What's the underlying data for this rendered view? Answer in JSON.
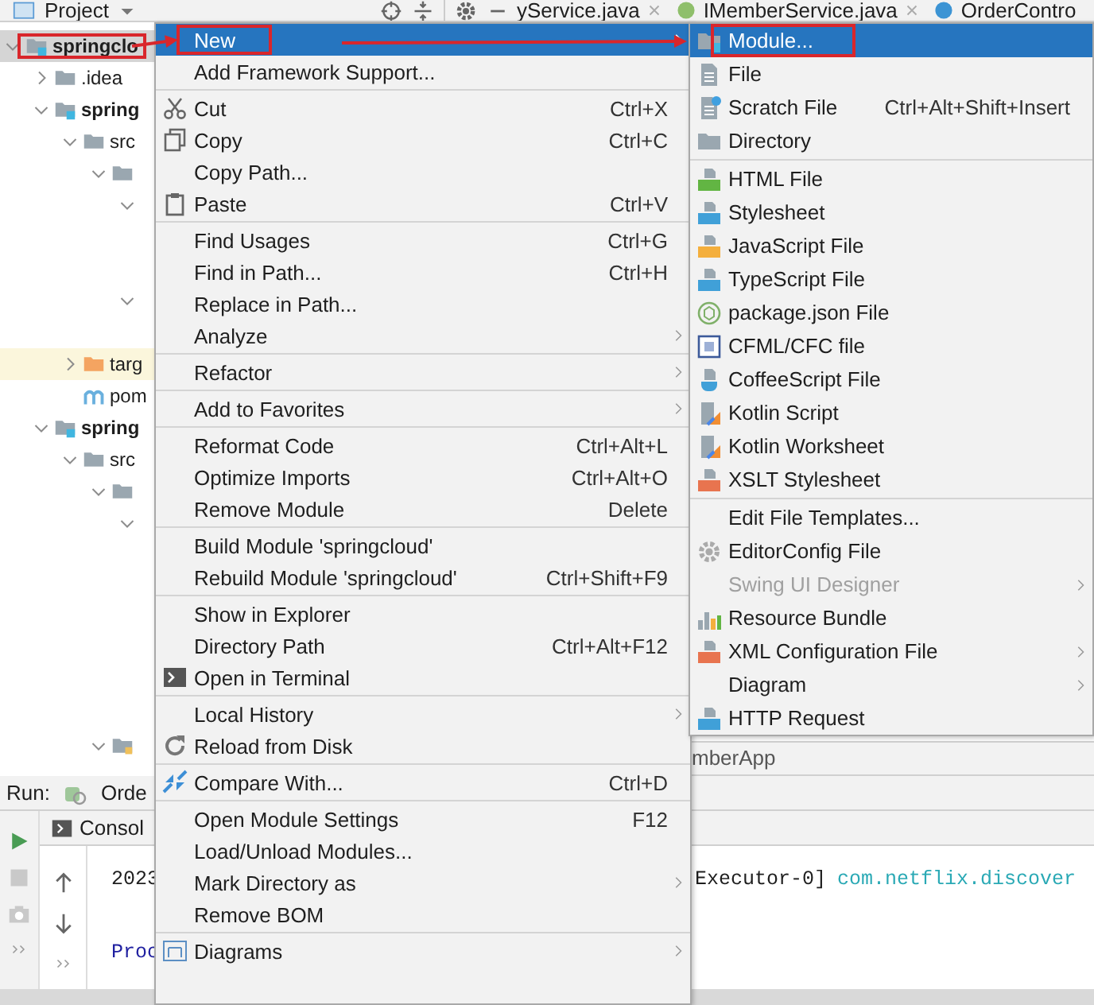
{
  "header": {
    "title": "Project",
    "tabs": [
      {
        "label": "yService.java",
        "kind": "cut",
        "closable": true
      },
      {
        "label": "IMemberService.java",
        "kind": "interface",
        "closable": true
      },
      {
        "label": "OrderContro",
        "kind": "class",
        "closable": false
      }
    ]
  },
  "tree": [
    {
      "kind": "module",
      "label": "springclo",
      "expanded": true,
      "selected": true,
      "annotated": true,
      "children": [
        {
          "kind": "folder",
          "label": ".idea",
          "expanded": false,
          "selected": false,
          "annotated": false
        },
        {
          "kind": "module",
          "label": "spring",
          "expanded": true,
          "selected": false,
          "annotated": false,
          "children": [
            {
              "kind": "folder",
              "label": "src",
              "expanded": true,
              "selected": false,
              "annotated": false,
              "children": [
                {
                  "kind": "folder",
                  "expanded": true,
                  "selected": false,
                  "annotated": false,
                  "children": [
                    {
                      "kind": "stub",
                      "expanded": true,
                      "children": [
                        {
                          "kind": "covered"
                        },
                        {
                          "kind": "covered"
                        }
                      ]
                    },
                    {
                      "kind": "stub",
                      "expanded": true,
                      "children": [
                        {
                          "kind": "covered"
                        }
                      ]
                    }
                  ]
                }
              ]
            },
            {
              "kind": "target",
              "label": "targ",
              "expanded": false,
              "selected": false,
              "annotated": false
            },
            {
              "kind": "maven",
              "label": "pom",
              "selected": false,
              "annotated": false
            }
          ]
        },
        {
          "kind": "module",
          "label": "spring",
          "expanded": true,
          "selected": false,
          "annotated": false,
          "children": [
            {
              "kind": "folder",
              "label": "src",
              "expanded": true,
              "selected": false,
              "annotated": false,
              "children": [
                {
                  "kind": "folder",
                  "expanded": true,
                  "selected": false,
                  "annotated": false,
                  "children": [
                    {
                      "kind": "stub",
                      "expanded": true,
                      "children": [
                        {
                          "kind": "covered"
                        },
                        {
                          "kind": "covered"
                        },
                        {
                          "kind": "covered"
                        },
                        {
                          "kind": "covered"
                        },
                        {
                          "kind": "covered"
                        },
                        {
                          "kind": "covered"
                        }
                      ]
                    }
                  ]
                },
                {
                  "kind": "package",
                  "expanded": true,
                  "selected": false,
                  "annotated": false
                }
              ]
            }
          ]
        }
      ]
    }
  ],
  "editor": {
    "band_label": "mberApp"
  },
  "run": {
    "title": "Run:",
    "config": "Orde"
  },
  "console": {
    "tab": "Consol",
    "lines": [
      {
        "kind": "plain",
        "text": "2023",
        "tail": [
          {
            "kind": "plain",
            "text": "Executor-0]"
          },
          {
            "kind": "logger",
            "text": "com.netflix.discover"
          }
        ]
      },
      {
        "kind": "blank"
      },
      {
        "kind": "process",
        "text": "Proc"
      }
    ]
  },
  "annotations": {
    "arrows": true
  },
  "context_menu": {
    "items": [
      {
        "kind": "plain",
        "label": "New",
        "submenu": true,
        "selected": true,
        "annotated": true
      },
      {
        "kind": "plain",
        "label": "Add Framework Support...",
        "submenu": false,
        "selected": false,
        "annotated": false
      },
      {
        "kind": "separator"
      },
      {
        "kind": "cut",
        "label": "Cut",
        "shortcut": "Ctrl+X",
        "submenu": false,
        "selected": false,
        "annotated": false
      },
      {
        "kind": "copy",
        "label": "Copy",
        "shortcut": "Ctrl+C",
        "submenu": false,
        "selected": false,
        "annotated": false
      },
      {
        "kind": "plain",
        "label": "Copy Path...",
        "submenu": false,
        "selected": false,
        "annotated": false
      },
      {
        "kind": "paste",
        "label": "Paste",
        "shortcut": "Ctrl+V",
        "submenu": false,
        "selected": false,
        "annotated": false
      },
      {
        "kind": "separator"
      },
      {
        "kind": "plain",
        "label": "Find Usages",
        "shortcut": "Ctrl+G",
        "submenu": false,
        "selected": false,
        "annotated": false
      },
      {
        "kind": "plain",
        "label": "Find in Path...",
        "shortcut": "Ctrl+H",
        "submenu": false,
        "selected": false,
        "annotated": false
      },
      {
        "kind": "plain",
        "label": "Replace in Path...",
        "submenu": false,
        "selected": false,
        "annotated": false
      },
      {
        "kind": "plain",
        "label": "Analyze",
        "submenu": true,
        "selected": false,
        "annotated": false
      },
      {
        "kind": "separator"
      },
      {
        "kind": "plain",
        "label": "Refactor",
        "submenu": true,
        "selected": false,
        "annotated": false
      },
      {
        "kind": "separator"
      },
      {
        "kind": "plain",
        "label": "Add to Favorites",
        "submenu": true,
        "selected": false,
        "annotated": false
      },
      {
        "kind": "separator"
      },
      {
        "kind": "plain",
        "label": "Reformat Code",
        "shortcut": "Ctrl+Alt+L",
        "submenu": false,
        "selected": false,
        "annotated": false
      },
      {
        "kind": "plain",
        "label": "Optimize Imports",
        "shortcut": "Ctrl+Alt+O",
        "submenu": false,
        "selected": false,
        "annotated": false
      },
      {
        "kind": "plain",
        "label": "Remove Module",
        "shortcut": "Delete",
        "submenu": false,
        "selected": false,
        "annotated": false
      },
      {
        "kind": "separator"
      },
      {
        "kind": "plain",
        "label": "Build Module 'springcloud'",
        "submenu": false,
        "selected": false,
        "annotated": false
      },
      {
        "kind": "plain",
        "label": "Rebuild Module 'springcloud'",
        "shortcut": "Ctrl+Shift+F9",
        "submenu": false,
        "selected": false,
        "annotated": false
      },
      {
        "kind": "separator"
      },
      {
        "kind": "plain",
        "label": "Show in Explorer",
        "submenu": false,
        "selected": false,
        "annotated": false
      },
      {
        "kind": "plain",
        "label": "Directory Path",
        "shortcut": "Ctrl+Alt+F12",
        "submenu": false,
        "selected": false,
        "annotated": false
      },
      {
        "kind": "terminal",
        "label": "Open in Terminal",
        "submenu": false,
        "selected": false,
        "annotated": false
      },
      {
        "kind": "separator"
      },
      {
        "kind": "plain",
        "label": "Local History",
        "submenu": true,
        "selected": false,
        "annotated": false
      },
      {
        "kind": "reload",
        "label": "Reload from Disk",
        "submenu": false,
        "selected": false,
        "annotated": false
      },
      {
        "kind": "separator"
      },
      {
        "kind": "compare",
        "label": "Compare With...",
        "shortcut": "Ctrl+D",
        "submenu": false,
        "selected": false,
        "annotated": false
      },
      {
        "kind": "separator"
      },
      {
        "kind": "plain",
        "label": "Open Module Settings",
        "shortcut": "F12",
        "submenu": false,
        "selected": false,
        "annotated": false
      },
      {
        "kind": "plain",
        "label": "Load/Unload Modules...",
        "submenu": false,
        "selected": false,
        "annotated": false
      },
      {
        "kind": "plain",
        "label": "Mark Directory as",
        "submenu": true,
        "selected": false,
        "annotated": false
      },
      {
        "kind": "plain",
        "label": "Remove BOM",
        "submenu": false,
        "selected": false,
        "annotated": false
      },
      {
        "kind": "separator"
      },
      {
        "kind": "diagrams",
        "label": "Diagrams",
        "submenu": true,
        "selected": false,
        "annotated": false
      }
    ]
  },
  "new_submenu": {
    "items": [
      {
        "kind": "module",
        "label": "Module...",
        "submenu": false,
        "selected": true,
        "annotated": true,
        "disabled": false
      },
      {
        "kind": "file",
        "label": "File",
        "submenu": false,
        "selected": false,
        "annotated": false,
        "disabled": false
      },
      {
        "kind": "scratch",
        "label": "Scratch File",
        "shortcut": "Ctrl+Alt+Shift+Insert",
        "submenu": false,
        "selected": false,
        "annotated": false,
        "disabled": false
      },
      {
        "kind": "directory",
        "label": "Directory",
        "submenu": false,
        "selected": false,
        "annotated": false,
        "disabled": false
      },
      {
        "kind": "separator"
      },
      {
        "kind": "html",
        "label": "HTML File",
        "submenu": false,
        "selected": false,
        "annotated": false,
        "disabled": false
      },
      {
        "kind": "css",
        "label": "Stylesheet",
        "submenu": false,
        "selected": false,
        "annotated": false,
        "disabled": false
      },
      {
        "kind": "js",
        "label": "JavaScript File",
        "submenu": false,
        "selected": false,
        "annotated": false,
        "disabled": false
      },
      {
        "kind": "ts",
        "label": "TypeScript File",
        "submenu": false,
        "selected": false,
        "annotated": false,
        "disabled": false
      },
      {
        "kind": "npm",
        "label": "package.json File",
        "submenu": false,
        "selected": false,
        "annotated": false,
        "disabled": false
      },
      {
        "kind": "cfml",
        "label": "CFML/CFC file",
        "submenu": false,
        "selected": false,
        "annotated": false,
        "disabled": false
      },
      {
        "kind": "coffee",
        "label": "CoffeeScript File",
        "submenu": false,
        "selected": false,
        "annotated": false,
        "disabled": false
      },
      {
        "kind": "kotlin",
        "label": "Kotlin Script",
        "submenu": false,
        "selected": false,
        "annotated": false,
        "disabled": false
      },
      {
        "kind": "kotlin",
        "label": "Kotlin Worksheet",
        "submenu": false,
        "selected": false,
        "annotated": false,
        "disabled": false
      },
      {
        "kind": "xslt",
        "label": "XSLT Stylesheet",
        "submenu": false,
        "selected": false,
        "annotated": false,
        "disabled": false
      },
      {
        "kind": "separator"
      },
      {
        "kind": "plain",
        "label": "Edit File Templates...",
        "submenu": false,
        "selected": false,
        "annotated": false,
        "disabled": false
      },
      {
        "kind": "editorconfig",
        "label": "EditorConfig File",
        "submenu": false,
        "selected": false,
        "annotated": false,
        "disabled": false
      },
      {
        "kind": "plain",
        "label": "Swing UI Designer",
        "submenu": true,
        "selected": false,
        "annotated": false,
        "disabled": true
      },
      {
        "kind": "bundle",
        "label": "Resource Bundle",
        "submenu": false,
        "selected": false,
        "annotated": false,
        "disabled": false
      },
      {
        "kind": "xml",
        "label": "XML Configuration File",
        "submenu": true,
        "selected": false,
        "annotated": false,
        "disabled": false
      },
      {
        "kind": "plain",
        "label": "Diagram",
        "submenu": true,
        "selected": false,
        "annotated": false,
        "disabled": false
      },
      {
        "kind": "http",
        "label": "HTTP Request",
        "submenu": false,
        "selected": false,
        "annotated": false,
        "disabled": false
      }
    ]
  }
}
